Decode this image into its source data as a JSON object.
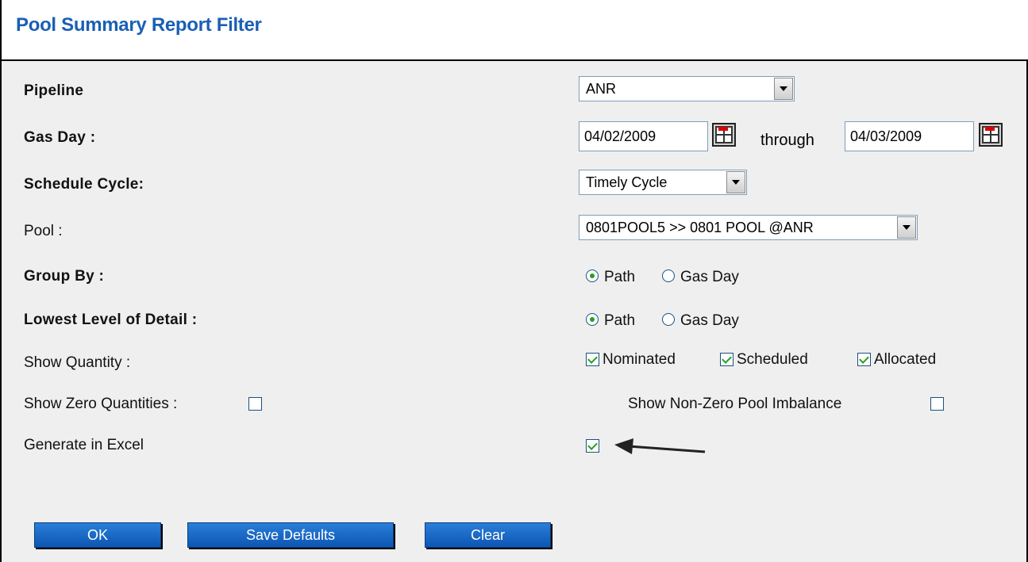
{
  "header": {
    "title": "Pool Summary Report Filter"
  },
  "fields": {
    "pipeline": {
      "label": "Pipeline",
      "value": "ANR"
    },
    "gas_day": {
      "label": "Gas Day :",
      "from": "04/02/2009",
      "through_label": "through",
      "to": "04/03/2009"
    },
    "schedule_cycle": {
      "label": "Schedule Cycle:",
      "value": "Timely Cycle"
    },
    "pool": {
      "label": "Pool :",
      "value": "0801POOL5 >> 0801 POOL @ANR"
    },
    "group_by": {
      "label": "Group By :",
      "options": [
        "Path",
        "Gas Day"
      ],
      "selected": "Path"
    },
    "lowest_level": {
      "label": "Lowest Level of Detail :",
      "options": [
        "Path",
        "Gas Day"
      ],
      "selected": "Path"
    },
    "show_quantity": {
      "label": "Show Quantity :",
      "options": [
        "Nominated",
        "Scheduled",
        "Allocated"
      ]
    },
    "show_zero": {
      "label": "Show Zero Quantities :",
      "checked": false
    },
    "show_nonzero_imbalance": {
      "label": "Show Non-Zero Pool Imbalance",
      "checked": false
    },
    "generate_excel": {
      "label": "Generate in Excel",
      "checked": true
    }
  },
  "buttons": {
    "ok": "OK",
    "save_defaults": "Save Defaults",
    "clear": "Clear"
  },
  "icons": {
    "calendar": "calendar-icon",
    "dropdown": "chevron-down-icon",
    "arrow": "arrow-left-icon"
  }
}
